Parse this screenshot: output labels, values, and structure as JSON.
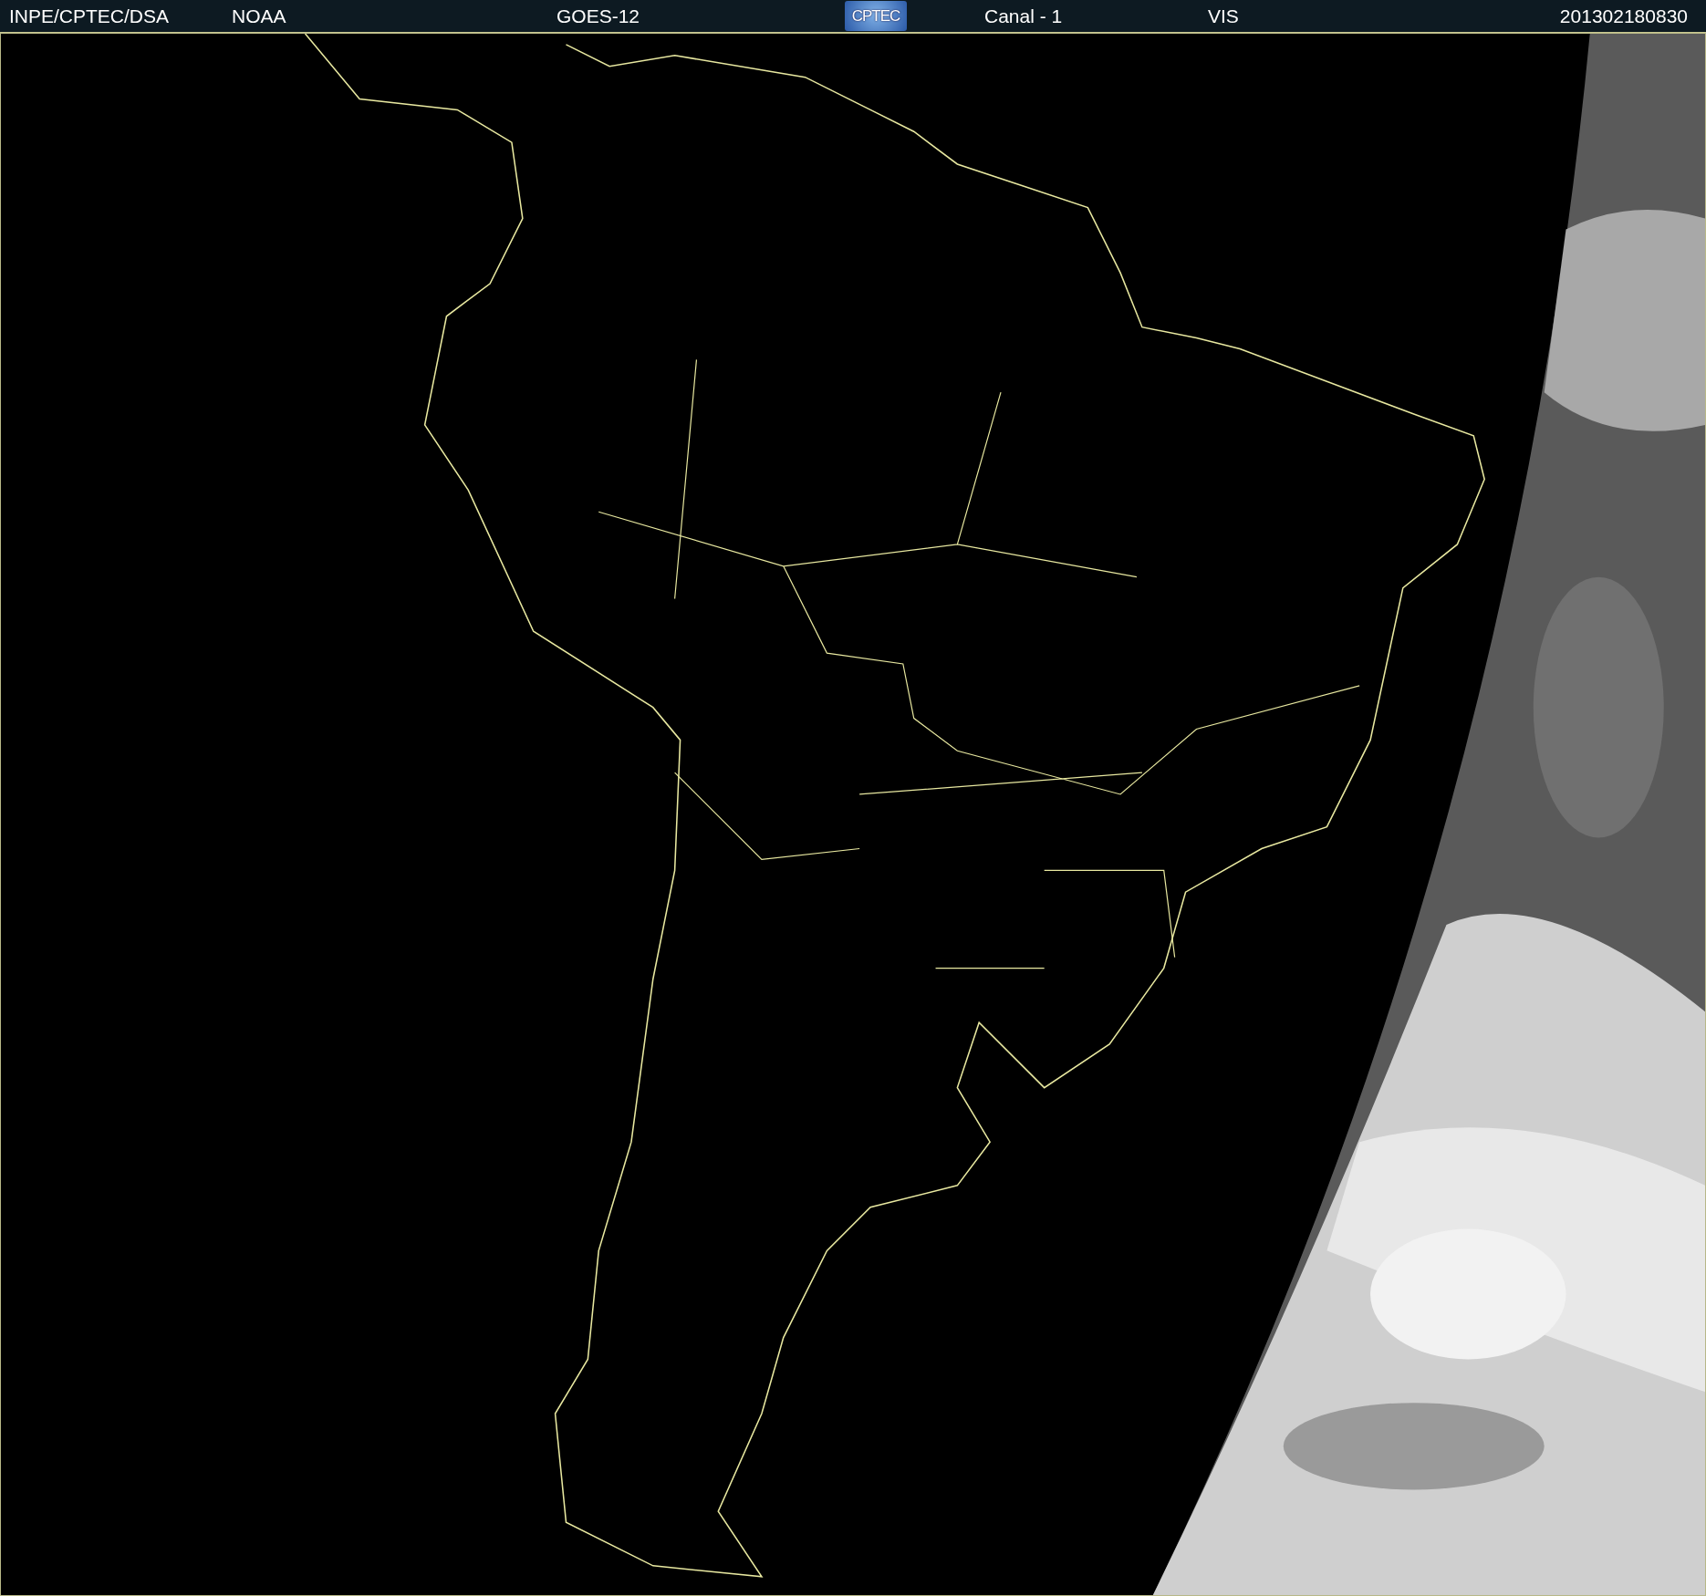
{
  "header": {
    "items": [
      {
        "kind": "text",
        "text": "INPE/CPTEC/DSA"
      },
      {
        "kind": "text",
        "text": "NOAA"
      },
      {
        "kind": "text",
        "text": "GOES-12"
      },
      {
        "kind": "logo",
        "text": "CPTEC"
      },
      {
        "kind": "text",
        "text": "Canal - 1"
      },
      {
        "kind": "text",
        "text": "VIS"
      },
      {
        "kind": "text",
        "text": "201302180830"
      }
    ]
  }
}
